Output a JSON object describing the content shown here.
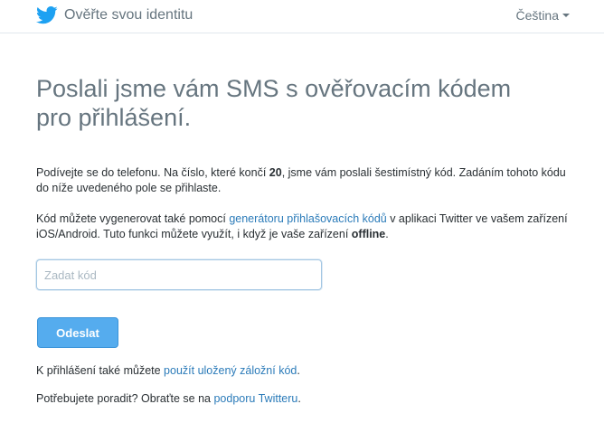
{
  "header": {
    "title": "Ověřte svou identitu",
    "language": "Čeština",
    "logo_icon": "twitter-bird-icon",
    "brand_color": "#1da1f2"
  },
  "main": {
    "heading_line1": "Poslali jsme vám SMS s ověřovacím kódem",
    "heading_line2": "pro přihlášení.",
    "info": {
      "text1": "Podívejte se do telefonu. Na číslo, které končí ",
      "number_suffix": "20",
      "text2": ", jsme vám poslali šestimístný kód. Zadáním tohoto kódu do níže uvedeného pole se přihlaste."
    },
    "generator": {
      "text1": "Kód můžete vygenerovat také pomocí ",
      "link": "generátoru přihlašovacích kódů",
      "text2": " v aplikaci Twitter ve vašem zařízení iOS/Android. Tuto funkci můžete využít, i když je vaše zařízení ",
      "bold": "offline",
      "text3": "."
    },
    "code_input": {
      "placeholder": "Zadat kód",
      "value": ""
    },
    "submit_label": "Odeslat",
    "backup": {
      "text": "K přihlášení také můžete ",
      "link": "použít uložený záložní kód",
      "end": "."
    },
    "help": {
      "text": "Potřebujete poradit? Obraťte se na ",
      "link": "podporu Twitteru",
      "end": "."
    }
  },
  "colors": {
    "accent": "#55acee",
    "link": "#2b7bb9",
    "heading": "#66757f"
  }
}
